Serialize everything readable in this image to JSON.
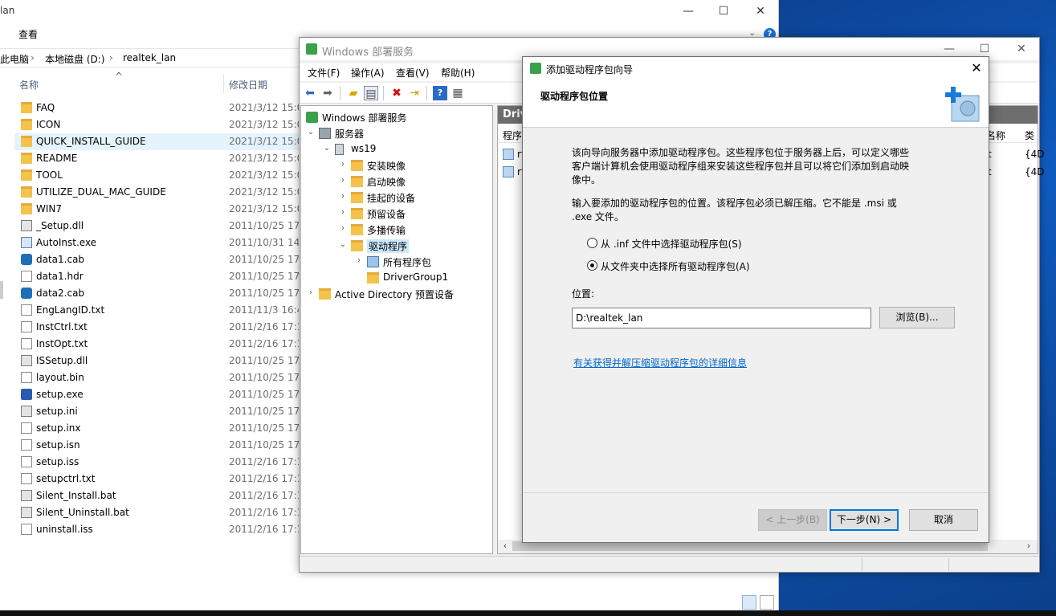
{
  "explorer": {
    "title": "lan",
    "ribbon_tab": "查看",
    "address": [
      "此电脑",
      "本地磁盘 (D:)",
      "realtek_lan"
    ],
    "column_name": "名称",
    "column_date": "修改日期",
    "files": [
      {
        "name": "FAQ",
        "date": "2021/3/12 15:0",
        "icon": "folder-icon"
      },
      {
        "name": "ICON",
        "date": "2021/3/12 15:0",
        "icon": "folder-icon"
      },
      {
        "name": "QUICK_INSTALL_GUIDE",
        "date": "2021/3/12 15:0",
        "icon": "folder-icon"
      },
      {
        "name": "README",
        "date": "2021/3/12 15:0",
        "icon": "folder-icon"
      },
      {
        "name": "TOOL",
        "date": "2021/3/12 15:0",
        "icon": "folder-icon"
      },
      {
        "name": "UTILIZE_DUAL_MAC_GUIDE",
        "date": "2021/3/12 15:0",
        "icon": "folder-icon"
      },
      {
        "name": "WIN7",
        "date": "2021/3/12 15:0",
        "icon": "folder-icon"
      },
      {
        "name": "_Setup.dll",
        "date": "2011/10/25 17:",
        "icon": "dll-icon"
      },
      {
        "name": "AutoInst.exe",
        "date": "2011/10/31 14:",
        "icon": "exe-icon"
      },
      {
        "name": "data1.cab",
        "date": "2011/10/25 17:",
        "icon": "cab-icon"
      },
      {
        "name": "data1.hdr",
        "date": "2011/10/25 17:",
        "icon": "file-icon"
      },
      {
        "name": "data2.cab",
        "date": "2011/10/25 17:",
        "icon": "cab-icon"
      },
      {
        "name": "EngLangID.txt",
        "date": "2011/11/3 16:4",
        "icon": "file-icon"
      },
      {
        "name": "InstCtrl.txt",
        "date": "2011/2/16 17:1",
        "icon": "file-icon"
      },
      {
        "name": "InstOpt.txt",
        "date": "2011/2/16 17:1",
        "icon": "file-icon"
      },
      {
        "name": "ISSetup.dll",
        "date": "2011/10/25 17:",
        "icon": "dll-icon"
      },
      {
        "name": "layout.bin",
        "date": "2011/10/25 17:",
        "icon": "file-icon"
      },
      {
        "name": "setup.exe",
        "date": "2011/10/25 17:",
        "icon": "setup-exe-icon"
      },
      {
        "name": "setup.ini",
        "date": "2011/10/25 17:",
        "icon": "ini-icon"
      },
      {
        "name": "setup.inx",
        "date": "2011/10/25 17:",
        "icon": "file-icon"
      },
      {
        "name": "setup.isn",
        "date": "2011/10/25 17:",
        "icon": "file-icon"
      },
      {
        "name": "setup.iss",
        "date": "2011/2/16 17:1",
        "icon": "file-icon"
      },
      {
        "name": "setupctrl.txt",
        "date": "2011/2/16 17:1",
        "icon": "file-icon"
      },
      {
        "name": "Silent_Install.bat",
        "date": "2011/2/16 17:1",
        "icon": "bat-icon"
      },
      {
        "name": "Silent_Uninstall.bat",
        "date": "2011/2/16 17:1",
        "icon": "bat-icon"
      },
      {
        "name": "uninstall.iss",
        "date": "2011/2/16 17:1",
        "icon": "file-icon"
      }
    ],
    "selected_index": 2
  },
  "wds": {
    "title": "Windows 部署服务",
    "menu": [
      "文件(F)",
      "操作(A)",
      "查看(V)",
      "帮助(H)"
    ],
    "tree": {
      "root": "Windows 部署服务",
      "servers": "服务器",
      "server": "ws19",
      "children": [
        "安装映像",
        "启动映像",
        "挂起的设备",
        "预留设备",
        "多播传输",
        "驱动程序"
      ],
      "driver_children": [
        "所有程序包",
        "DriverGroup1"
      ],
      "ad": "Active Directory 预置设备"
    },
    "right_header": "Driv",
    "right_col_program": "程序",
    "right_col_name": "名称",
    "right_col_type": "类",
    "right_rows": [
      {
        "a": "rt",
        "b": "t",
        "c": "{4D"
      },
      {
        "a": "rt",
        "b": "t",
        "c": "{4D"
      }
    ]
  },
  "wizard": {
    "title": "添加驱动程序包向导",
    "header": "驱动程序包位置",
    "intro": "该向导向服务器中添加驱动程序包。这些程序包位于服务器上后，可以定义哪些客户端计算机会使用驱动程序组来安装这些程序包并且可以将它们添加到启动映像中。",
    "prompt": "输入要添加的驱动程序包的位置。该程序包必须已解压缩。它不能是 .msi 或 .exe 文件。",
    "option_inf": "从 .inf 文件中选择驱动程序包(S)",
    "option_folder": "从文件夹中选择所有驱动程序包(A)",
    "selected_option": "folder",
    "location_label": "位置:",
    "location_value": "D:\\realtek_lan",
    "browse": "浏览(B)...",
    "link": "有关获得并解压缩驱动程序包的详细信息",
    "back": "< 上一步(B)",
    "next": "下一步(N) >",
    "cancel": "取消"
  }
}
